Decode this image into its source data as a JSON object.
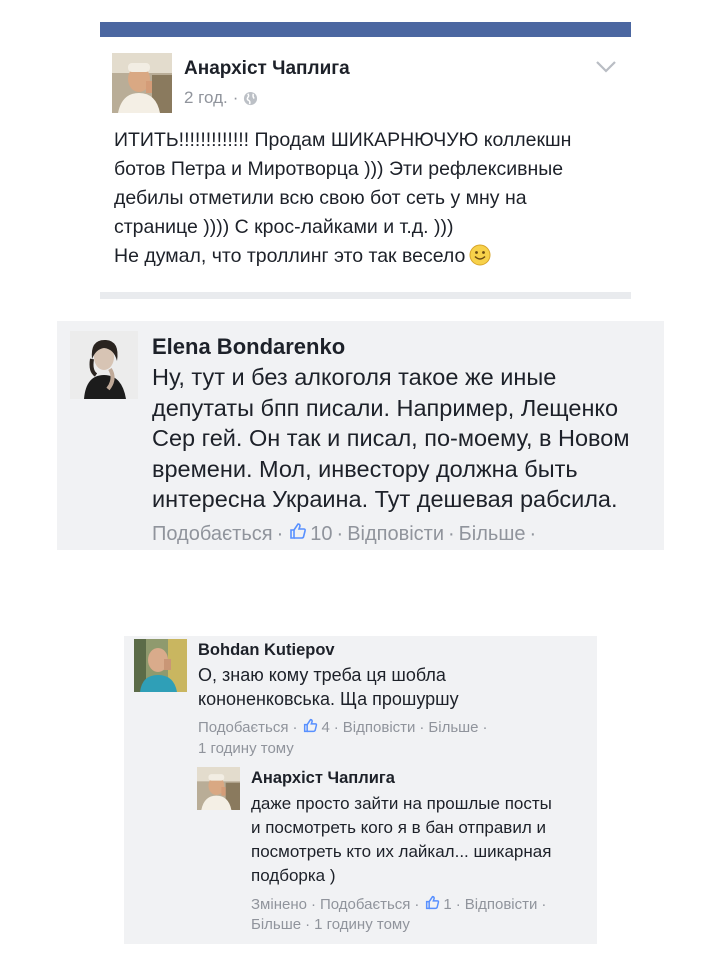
{
  "post": {
    "author": "Анархіст Чаплига",
    "time": "2 год.",
    "meta_separator": "·",
    "lines": [
      "ИТИТЬ!!!!!!!!!!!!! Продам ШИКАРНЮЧУЮ коллекшн",
      "ботов Петра и Миротворца ))) Эти рефлексивные",
      "дебилы отметили всю свою бот сеть у мну на",
      "странице )))) С крос-лайками и т.д. )))",
      "Не думал, что троллинг это так весело"
    ]
  },
  "comment1": {
    "author": "Elena Bondarenko",
    "lines": [
      "Ну, тут и без алкоголя такое же иные",
      "депутаты бпп писали. Например, Лещенко",
      "Сер гей. Он так и писал, по-моему, в Новом",
      "времени. Мол, инвестору должна быть",
      "интересна Украина. Тут дешевая рабсила."
    ],
    "like": "Подобається",
    "count": "10",
    "reply": "Відповісти",
    "more": "Більше"
  },
  "comment2": {
    "author": "Bohdan Kutiepov",
    "lines": [
      "О, знаю кому треба ця шобла",
      "кононенковська. Ща прошуршу"
    ],
    "like": "Подобається",
    "count": "4",
    "reply": "Відповісти",
    "more": "Більше",
    "time": "1 годину тому"
  },
  "reply": {
    "author": "Анархіст Чаплига",
    "lines": [
      "даже просто зайти на прошлые посты",
      "и посмотреть кого я в бан отправил и",
      "посмотреть кто их лайкал... шикарная",
      "подборка )"
    ],
    "edited": "Змінено",
    "like": "Подобається",
    "count": "1",
    "reply_label": "Відповісти",
    "more": "Більше",
    "time": "1 годину тому"
  },
  "icons": {
    "globe": "globe-icon",
    "chevron": "chevron-down-icon",
    "like": "thumbs-up-icon",
    "smiley": "smiley-icon"
  },
  "colors": {
    "header_blue": "#4b67a1",
    "muted_text": "#90949c",
    "comment_bg": "#f1f2f4",
    "like_blue": "#5890ff"
  }
}
